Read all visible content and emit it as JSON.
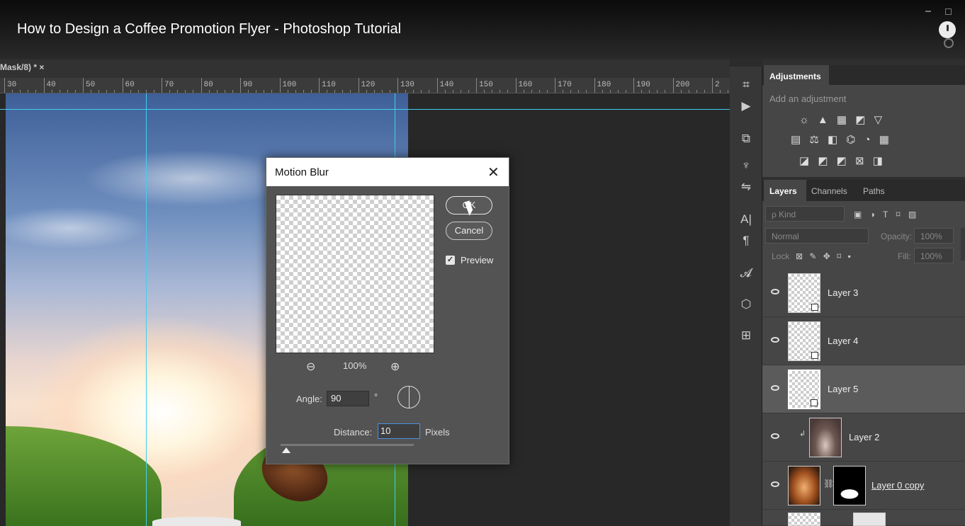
{
  "video": {
    "title": "How to Design a Coffee Promotion Flyer - Photoshop Tutorial"
  },
  "document": {
    "tab_label": "Mask/8) * ×"
  },
  "ruler": {
    "ticks": [
      "30",
      "40",
      "50",
      "60",
      "70",
      "80",
      "90",
      "100",
      "110",
      "120",
      "130",
      "140",
      "150",
      "160",
      "170",
      "180",
      "190",
      "200",
      "2"
    ]
  },
  "dialog": {
    "title": "Motion Blur",
    "close": "✕",
    "ok_label": "OK",
    "cancel_label": "Cancel",
    "preview_label": "Preview",
    "preview_checked": true,
    "zoom_out": "⊖",
    "zoom_level": "100%",
    "zoom_in": "⊕",
    "angle_label": "Angle:",
    "angle_value": "90",
    "degree": "°",
    "distance_label": "Distance:",
    "distance_value": "10",
    "unit": "Pixels"
  },
  "tools": [
    "⌗",
    "▶",
    "⧉",
    "♆",
    "⇋",
    "A|",
    "¶",
    "𝓐",
    "⬡",
    "⊞"
  ],
  "adjustments": {
    "tab": "Adjustments",
    "hint": "Add an adjustment",
    "rows": [
      "☼ ▲ ▦ ◩ ▽",
      "▤ ⚖ ◧ ⌬ ◔ ▦",
      "◪ ◩ ◩ ⊠ ◨"
    ]
  },
  "layers_panel": {
    "tabs": [
      "Layers",
      "Channels",
      "Paths"
    ],
    "filter_kind": "ρ Kind",
    "filter_icons": "▣ ◑ T ⌑ ▨",
    "blend_mode": "Normal",
    "opacity_label": "Opacity:",
    "opacity_value": "100%",
    "lock_label": "Lock:",
    "lock_icons": "⊠ ✎ ✥ ⌑ ▪",
    "fill_label": "Fill:",
    "fill_value": "100%",
    "layers": [
      {
        "name": "Layer 3"
      },
      {
        "name": "Layer 4"
      },
      {
        "name": "Layer 5",
        "selected": true
      },
      {
        "name": "Layer 2"
      },
      {
        "name": "Layer 0 copy"
      }
    ]
  },
  "colors": {
    "guide": "#3fd0f0",
    "panel": "#464646",
    "accent": "#4a90e2"
  }
}
